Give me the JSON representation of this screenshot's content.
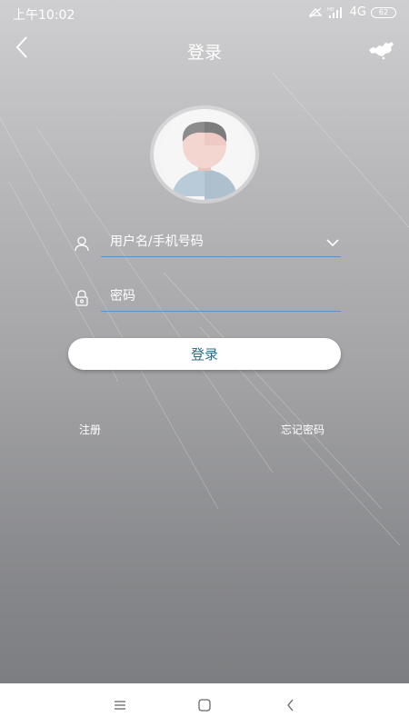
{
  "status_bar": {
    "time": "上午10:02",
    "network": "4G",
    "hd_label": "HD",
    "battery": "62"
  },
  "header": {
    "title": "登录",
    "back_icon": "chevron-left-icon",
    "map_icon": "china-map-icon"
  },
  "avatar": {
    "icon": "default-user-avatar"
  },
  "form": {
    "username_placeholder": "用户名/手机号码",
    "username_value": "",
    "password_placeholder": "密码",
    "password_value": "",
    "login_label": "登录"
  },
  "links": {
    "register": "注册",
    "forgot_password": "忘记密码"
  },
  "colors": {
    "accent_underline": "#5a8fd0",
    "login_text": "#2f6c86",
    "background_top": "#cfcfd1",
    "background_bottom": "#7d7e81"
  },
  "nav_bar": {
    "icons": [
      "menu-icon",
      "home-icon",
      "back-icon"
    ]
  }
}
